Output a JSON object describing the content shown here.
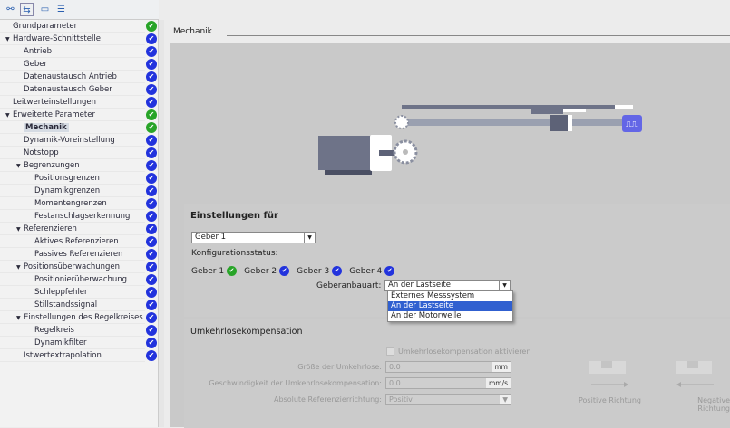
{
  "toolbar": {
    "icons": [
      "link-icon",
      "expand-icon",
      "folder-icon",
      "list-icon"
    ]
  },
  "tree": [
    {
      "label": "Grundparameter",
      "level": 0,
      "status": "green"
    },
    {
      "label": "Hardware-Schnittstelle",
      "level": 0,
      "expanded": true,
      "status": "blue"
    },
    {
      "label": "Antrieb",
      "level": 1,
      "status": "blue"
    },
    {
      "label": "Geber",
      "level": 1,
      "status": "blue"
    },
    {
      "label": "Datenaustausch Antrieb",
      "level": 1,
      "status": "blue"
    },
    {
      "label": "Datenaustausch Geber",
      "level": 1,
      "status": "blue"
    },
    {
      "label": "Leitwerteinstellungen",
      "level": 0,
      "status": "blue"
    },
    {
      "label": "Erweiterte Parameter",
      "level": 0,
      "expanded": true,
      "status": "green"
    },
    {
      "label": "Mechanik",
      "level": 1,
      "status": "green",
      "selected": true
    },
    {
      "label": "Dynamik-Voreinstellung",
      "level": 1,
      "status": "blue"
    },
    {
      "label": "Notstopp",
      "level": 1,
      "status": "blue"
    },
    {
      "label": "Begrenzungen",
      "level": 1,
      "expanded": true,
      "status": "blue"
    },
    {
      "label": "Positionsgrenzen",
      "level": 2,
      "status": "blue"
    },
    {
      "label": "Dynamikgrenzen",
      "level": 2,
      "status": "blue"
    },
    {
      "label": "Momentengrenzen",
      "level": 2,
      "status": "blue"
    },
    {
      "label": "Festanschlagserkennung",
      "level": 2,
      "status": "blue"
    },
    {
      "label": "Referenzieren",
      "level": 1,
      "expanded": true,
      "status": "blue"
    },
    {
      "label": "Aktives Referenzieren",
      "level": 2,
      "status": "blue"
    },
    {
      "label": "Passives Referenzieren",
      "level": 2,
      "status": "blue"
    },
    {
      "label": "Positionsüberwachungen",
      "level": 1,
      "expanded": true,
      "status": "blue"
    },
    {
      "label": "Positionierüberwachung",
      "level": 2,
      "status": "blue"
    },
    {
      "label": "Schleppfehler",
      "level": 2,
      "status": "blue"
    },
    {
      "label": "Stillstandssignal",
      "level": 2,
      "status": "blue"
    },
    {
      "label": "Einstellungen des Regelkreises",
      "level": 1,
      "expanded": true,
      "status": "blue"
    },
    {
      "label": "Regelkreis",
      "level": 2,
      "status": "blue"
    },
    {
      "label": "Dynamikfilter",
      "level": 2,
      "status": "blue"
    },
    {
      "label": "Istwertextrapolation",
      "level": 1,
      "status": "blue"
    }
  ],
  "main": {
    "title": "Mechanik",
    "settings": {
      "heading": "Einstellungen für",
      "geber_select": "Geber 1",
      "config_label": "Konfigurationsstatus:",
      "geber_status": [
        {
          "label": "Geber 1",
          "status": "green"
        },
        {
          "label": "Geber 2",
          "status": "blue"
        },
        {
          "label": "Geber 3",
          "status": "blue"
        },
        {
          "label": "Geber 4",
          "status": "blue"
        }
      ],
      "anbau_label": "Geberanbauart:",
      "anbau_value": "An der Lastseite",
      "anbau_options": [
        "Externes Messsystem",
        "An der Lastseite",
        "An der Motorwelle"
      ]
    },
    "backlash": {
      "heading": "Umkehrlosekompensation",
      "checkbox": "Umkehrlosekompensation aktivieren",
      "size_label": "Größe der Umkehrlose:",
      "size_value": "0.0",
      "size_unit": "mm",
      "speed_label": "Geschwindigkeit der Umkehrlosekompensation:",
      "speed_value": "0.0",
      "speed_unit": "mm/s",
      "dir_label": "Absolute Referenzierrichtung:",
      "dir_value": "Positiv",
      "pos_label": "Positive Richtung",
      "neg_label": "Negative Richtung"
    }
  },
  "colors": {
    "green": "#28a428",
    "blue": "#2233dd",
    "accent": "#3060d0"
  }
}
